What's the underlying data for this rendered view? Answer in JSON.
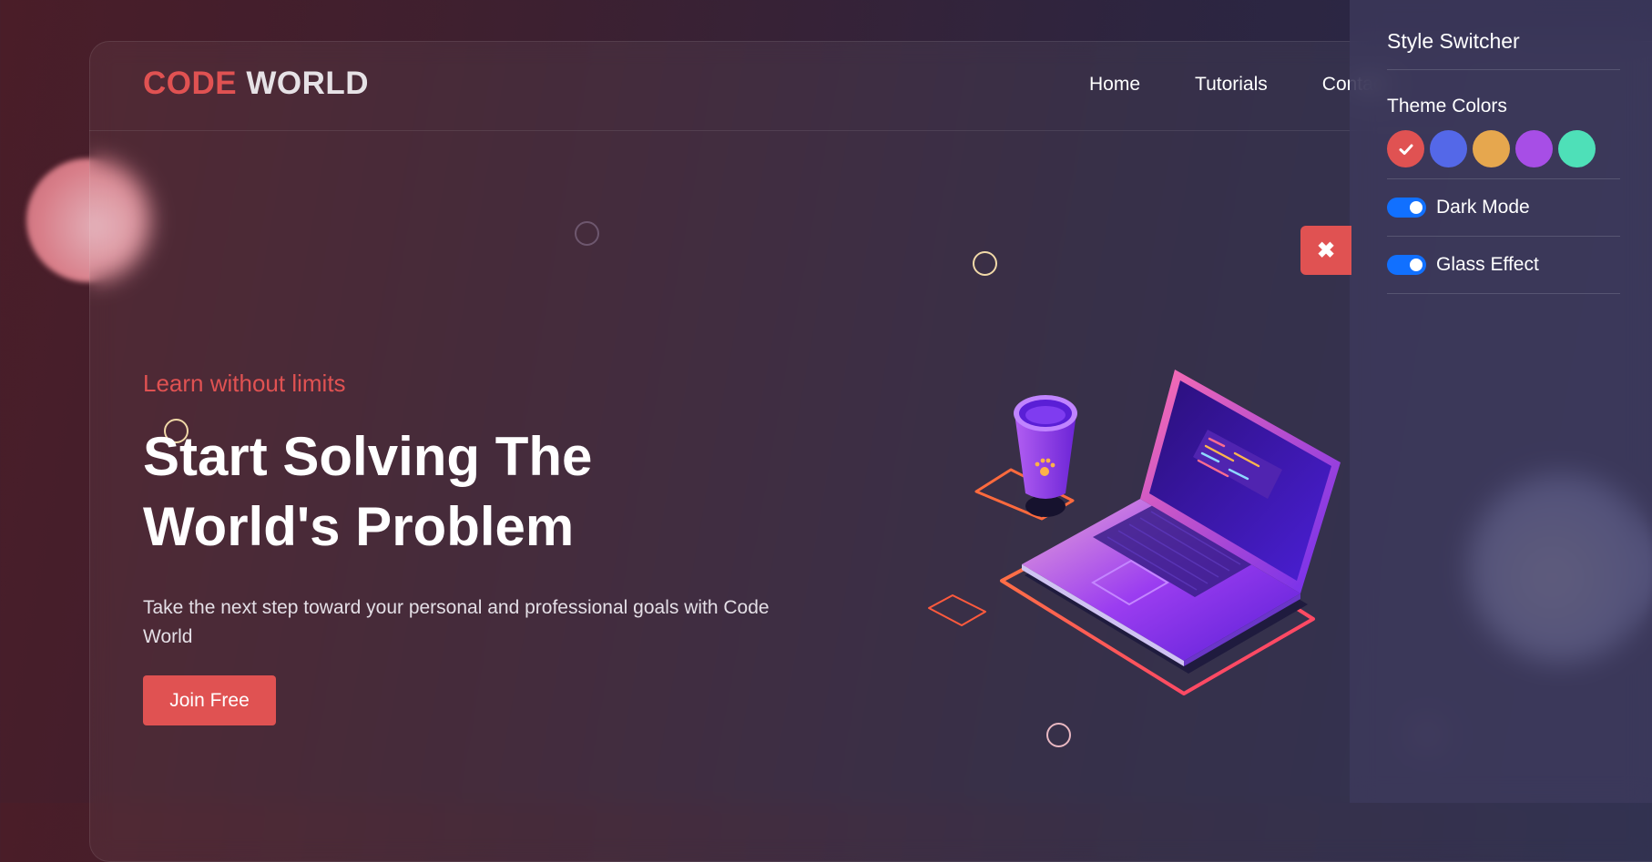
{
  "logo": {
    "part1": "CODE",
    "part2": "WORLD"
  },
  "nav": {
    "items": [
      "Home",
      "Tutorials",
      "Contact"
    ]
  },
  "hero": {
    "tagline": "Learn without limits",
    "title_line1": "Start Solving The",
    "title_line2": "World's Problem",
    "description": "Take the next step toward your personal and professional goals with Code World",
    "cta_label": "Join Free"
  },
  "close_icon": "close-icon",
  "style_switcher": {
    "title": "Style Switcher",
    "theme_colors_label": "Theme Colors",
    "theme_colors": [
      "#e05252",
      "#5468e8",
      "#e6a74e",
      "#a74ee6",
      "#4ee0b8"
    ],
    "selected_color_index": 0,
    "dark_mode_label": "Dark Mode",
    "dark_mode_on": true,
    "glass_effect_label": "Glass Effect",
    "glass_effect_on": true
  },
  "colors": {
    "accent": "#e05252",
    "toggle": "#1170ff"
  }
}
